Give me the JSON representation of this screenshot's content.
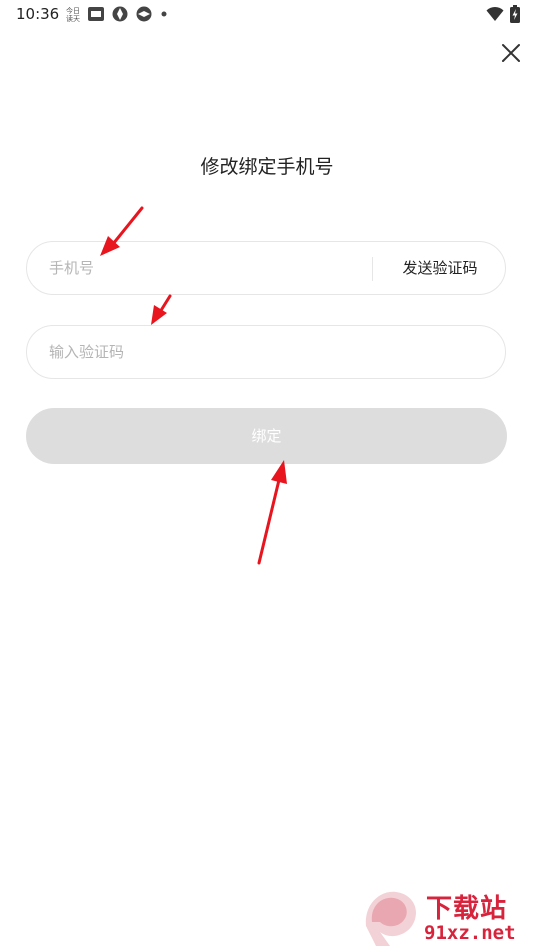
{
  "status_bar": {
    "time": "10:36"
  },
  "page": {
    "title": "修改绑定手机号"
  },
  "form": {
    "phone_placeholder": "手机号",
    "send_code_label": "发送验证码",
    "code_placeholder": "输入验证码",
    "bind_label": "绑定"
  },
  "watermark": {
    "logo_text": "下载站",
    "domain": "91xz.net"
  },
  "colors": {
    "accent_red": "#d8233c",
    "button_disabled": "#dddddd",
    "annotation_arrow": "#e8141e"
  },
  "icons": {
    "close": "close-icon",
    "wifi": "wifi-icon",
    "battery": "battery-charging-icon"
  }
}
